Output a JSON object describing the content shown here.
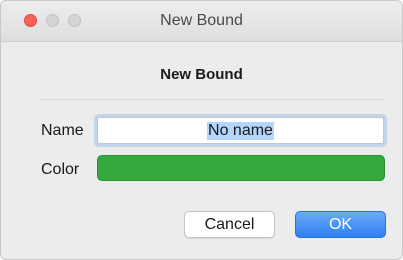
{
  "window": {
    "title": "New Bound"
  },
  "dialog": {
    "heading": "New Bound",
    "name_label": "Name",
    "name_value": "No name",
    "color_label": "Color",
    "color_value": "#35a93b"
  },
  "buttons": {
    "cancel_label": "Cancel",
    "ok_label": "OK"
  },
  "colors": {
    "accent": "#2e7ff2",
    "close": "#fc605b",
    "selection": "#b4d5fe"
  }
}
